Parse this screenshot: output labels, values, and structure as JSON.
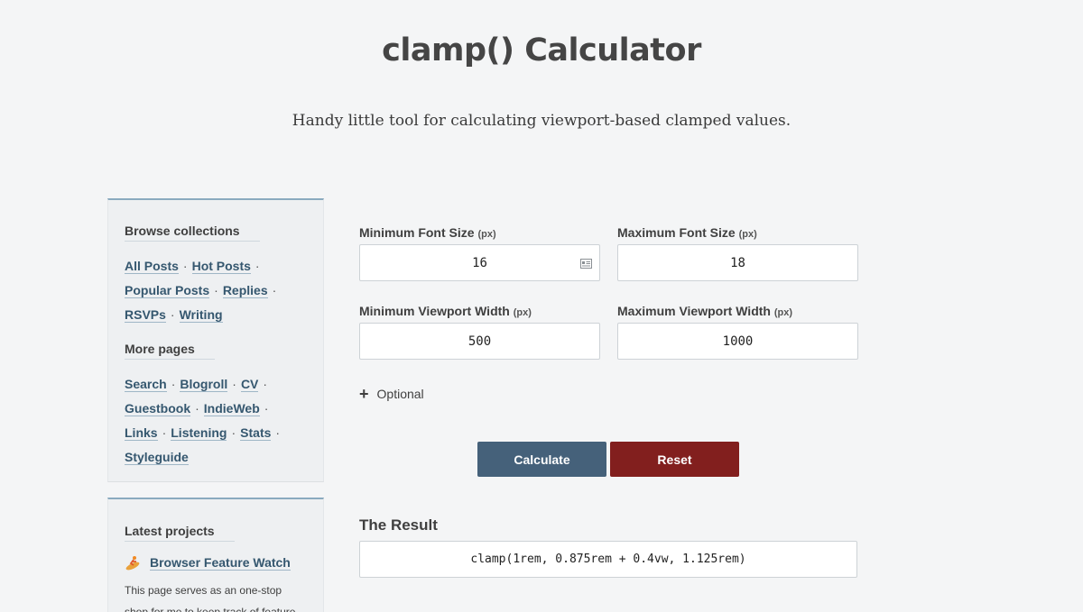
{
  "page": {
    "title": "clamp() Calculator",
    "subtitle": "Handy little tool for calculating viewport-based clamped values."
  },
  "sidebar": {
    "browse_heading": "Browse collections",
    "browse_links": [
      "All Posts",
      "Hot Posts",
      "Popular Posts",
      "Replies",
      "RSVPs",
      "Writing"
    ],
    "more_heading": "More pages",
    "more_links": [
      "Search",
      "Blogroll",
      "CV",
      "Guestbook",
      "IndieWeb",
      "Links",
      "Listening",
      "Stats",
      "Styleguide"
    ],
    "separator": "·",
    "projects_heading": "Latest projects",
    "project_title": "Browser Feature Watch",
    "project_icon": "surfer-icon",
    "project_desc_line1": "This page serves as an one-stop",
    "project_desc_line2": "shop for me to keep track of feature"
  },
  "form": {
    "min_font_label": "Minimum Font Size",
    "max_font_label": "Maximum Font Size",
    "min_vw_label": "Minimum Viewport Width",
    "max_vw_label": "Maximum Viewport Width",
    "unit": "(px)",
    "min_font_value": "16",
    "max_font_value": "18",
    "min_vw_value": "500",
    "max_vw_value": "1000",
    "optional_label": "Optional",
    "optional_icon": "plus-icon",
    "calculate_label": "Calculate",
    "reset_label": "Reset"
  },
  "result": {
    "heading": "The Result",
    "value": "clamp(1rem, 0.875rem + 0.4vw, 1.125rem)"
  },
  "colors": {
    "calculate_bg": "#45617a",
    "reset_bg": "#821f1e",
    "link": "#35576f",
    "accent_border": "#8aaabf"
  }
}
